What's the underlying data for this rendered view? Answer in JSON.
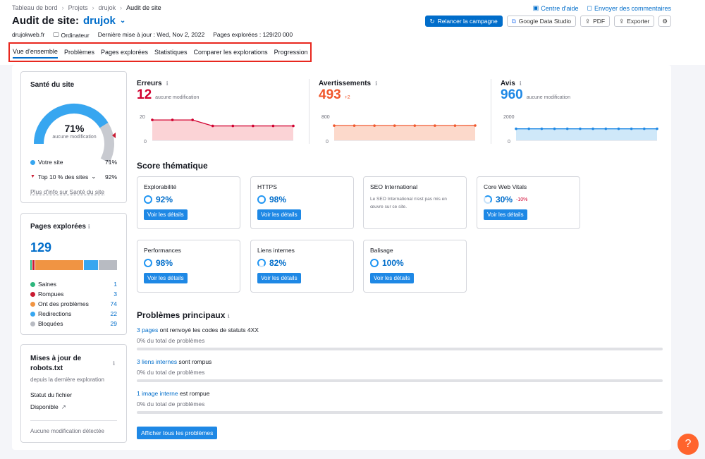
{
  "breadcrumb": {
    "items": [
      "Tableau de bord",
      "Projets",
      "drujok",
      "Audit de site"
    ]
  },
  "header": {
    "title_prefix": "Audit de site:",
    "project": "drujok",
    "domain": "drujokweb.fr",
    "device": "Ordinateur",
    "updated": "Dernière mise à jour : Wed, Nov 2, 2022",
    "pages": "Pages explorées : 129/20 000"
  },
  "help": {
    "center": "Centre d'aide",
    "feedback": "Envoyer des commentaires"
  },
  "actions": {
    "relaunch": "Relancer la campagne",
    "gds": "Google Data Studio",
    "pdf": "PDF",
    "export": "Exporter"
  },
  "tabs": [
    "Vue d'ensemble",
    "Problèmes",
    "Pages explorées",
    "Statistiques",
    "Comparer les explorations",
    "Progression"
  ],
  "health": {
    "title": "Santé du site",
    "percent": "71%",
    "sub": "aucune modification",
    "value": 71,
    "legend": [
      {
        "label": "Votre site",
        "value": "71%"
      },
      {
        "label": "Top 10 % des sites",
        "value": "92%"
      }
    ],
    "link": "Plus d'info sur Santé du site"
  },
  "crawled": {
    "title": "Pages explorées",
    "total": "129",
    "items": [
      {
        "label": "Saines",
        "value": "1",
        "count": 1,
        "color": "#2eb67d"
      },
      {
        "label": "Rompues",
        "value": "3",
        "count": 3,
        "color": "#c91b32"
      },
      {
        "label": "Ont des problèmes",
        "value": "74",
        "count": 74,
        "color": "#f09443"
      },
      {
        "label": "Redirections",
        "value": "22",
        "count": 22,
        "color": "#37a6f0"
      },
      {
        "label": "Bloquées",
        "value": "29",
        "count": 29,
        "color": "#b8bbc2"
      }
    ]
  },
  "robots": {
    "title": "Mises à jour de robots.txt",
    "since": "depuis la dernière exploration",
    "status_label": "Statut du fichier",
    "status": "Disponible",
    "footer": "Aucune modification détectée"
  },
  "kpis": [
    {
      "label": "Erreurs",
      "value": "12",
      "note": "aucune modification",
      "delta": "",
      "color": "#d1002f",
      "fill": "#fbd3d6",
      "ymax": "20",
      "ymin": "0",
      "ymax_val": 20,
      "points": [
        17,
        17,
        17,
        12,
        12,
        12,
        12,
        12
      ]
    },
    {
      "label": "Avertissements",
      "value": "493",
      "note": "",
      "delta": "+2",
      "color": "#f0572c",
      "fill": "#fcd9cb",
      "ymax": "800",
      "ymin": "0",
      "ymax_val": 800,
      "points": [
        491,
        491,
        491,
        491,
        491,
        491,
        491,
        493
      ]
    },
    {
      "label": "Avis",
      "value": "960",
      "note": "aucune modification",
      "delta": "",
      "color": "#1e88e5",
      "fill": "#cfe8f9",
      "ymax": "2000",
      "ymin": "0",
      "ymax_val": 2000,
      "points": [
        960,
        960,
        960,
        960,
        960,
        960,
        960,
        960,
        960,
        960,
        960,
        960
      ]
    }
  ],
  "themes_title": "Score thématique",
  "themes": [
    {
      "name": "Explorabilité",
      "pct": "92%",
      "delta": "",
      "desc": "",
      "button": "Voir les détails"
    },
    {
      "name": "HTTPS",
      "pct": "98%",
      "delta": "",
      "desc": "",
      "button": "Voir les détails"
    },
    {
      "name": "SEO International",
      "pct": "",
      "delta": "",
      "desc": "Le SEO International n'est pas mis en œuvre sur ce site.",
      "button": ""
    },
    {
      "name": "Core Web Vitals",
      "pct": "30%",
      "delta": "-10%",
      "desc": "",
      "button": "Voir les détails"
    },
    {
      "name": "Performances",
      "pct": "98%",
      "delta": "",
      "desc": "",
      "button": "Voir les détails"
    },
    {
      "name": "Liens internes",
      "pct": "82%",
      "delta": "",
      "desc": "",
      "button": "Voir les détails"
    },
    {
      "name": "Balisage",
      "pct": "100%",
      "delta": "",
      "desc": "",
      "button": "Voir les détails"
    }
  ],
  "problems_title": "Problèmes principaux",
  "problems": [
    {
      "link": "3 pages",
      "text": " ont renvoyé les codes de statuts 4XX",
      "sub": "0% du total de problèmes"
    },
    {
      "link": "3 liens internes",
      "text": " sont rompus",
      "sub": "0% du total de problèmes"
    },
    {
      "link": "1 image interne",
      "text": " est rompue",
      "sub": "0% du total de problèmes"
    }
  ],
  "problems_button": "Afficher tous les problèmes",
  "fab": "?"
}
